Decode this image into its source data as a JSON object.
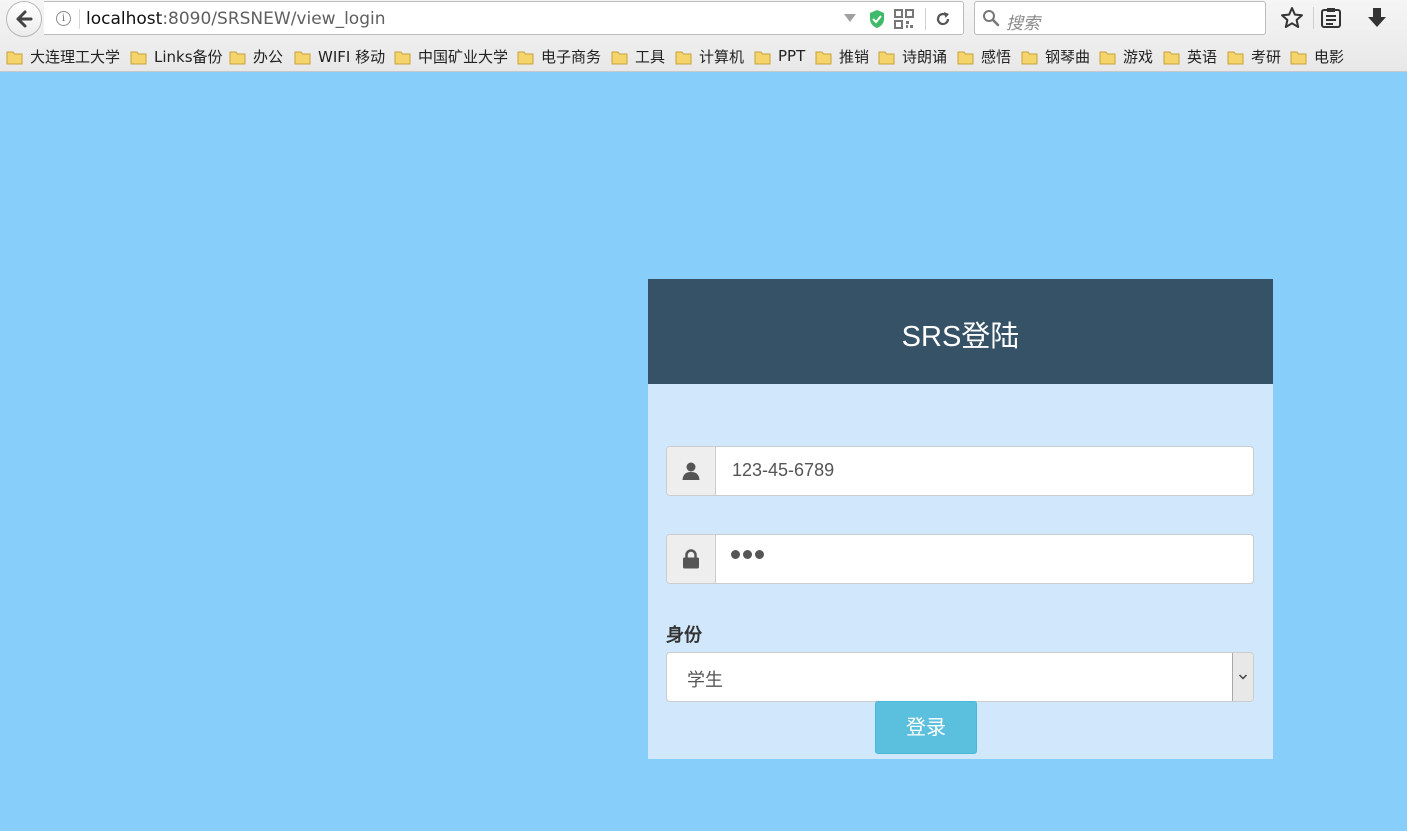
{
  "browser": {
    "url_host": "localhost",
    "url_path": ":8090/SRSNEW/view_login",
    "search_placeholder": "搜索"
  },
  "bookmarks": [
    {
      "label": "大连理工大学"
    },
    {
      "label": "Links备份"
    },
    {
      "label": "办公"
    },
    {
      "label": "WIFI 移动"
    },
    {
      "label": "中国矿业大学"
    },
    {
      "label": "电子商务"
    },
    {
      "label": "工具"
    },
    {
      "label": "计算机"
    },
    {
      "label": "PPT"
    },
    {
      "label": "推销"
    },
    {
      "label": "诗朗诵"
    },
    {
      "label": "感悟"
    },
    {
      "label": "钢琴曲"
    },
    {
      "label": "游戏"
    },
    {
      "label": "英语"
    },
    {
      "label": "考研"
    },
    {
      "label": "电影"
    }
  ],
  "login": {
    "title": "SRS登陆",
    "username_value": "123-45-6789",
    "role_label": "身份",
    "role_selected": "学生",
    "submit_label": "登录"
  },
  "colors": {
    "page_background": "#87cefa",
    "panel_background": "#d1e7fb",
    "header_background": "#365266",
    "button_background": "#5bc0de"
  }
}
